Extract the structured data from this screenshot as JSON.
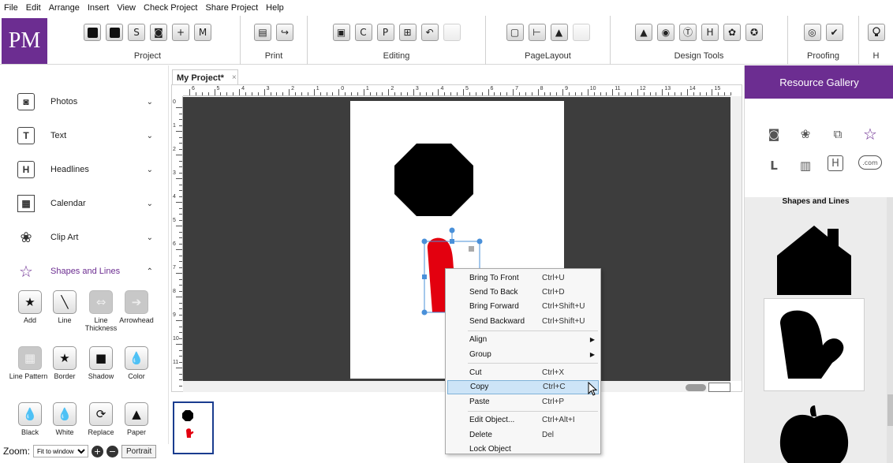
{
  "menu": [
    "File",
    "Edit",
    "Arrange",
    "Insert",
    "View",
    "Check Project",
    "Share Project",
    "Help"
  ],
  "app": {
    "logo": "PM"
  },
  "ribbon": {
    "groups": [
      {
        "label": "Project"
      },
      {
        "label": "Print"
      },
      {
        "label": "Editing"
      },
      {
        "label": "PageLayout"
      },
      {
        "label": "Design Tools"
      },
      {
        "label": "Proofing"
      },
      {
        "label": "H"
      }
    ],
    "glyphs": {
      "project_2": "S",
      "project_3": "◙",
      "project_4": "+",
      "project_5": "M",
      "print_1": "▤",
      "print_2": "↪",
      "editing_1": "▣",
      "editing_2": "C",
      "editing_3": "P",
      "editing_4": "⊞",
      "editing_5": "↶",
      "layout_1": "▢",
      "layout_2": "⊢",
      "layout_3": "▲",
      "design_1": "▲",
      "design_2": "◉",
      "design_3": "Ⓣ",
      "design_4": "H",
      "design_5": "✿",
      "design_6": "✪",
      "proof_1": "◎",
      "proof_2": "✔",
      "help_1": "💡"
    }
  },
  "left_panel": {
    "items": [
      {
        "label": "Photos",
        "icon": "camera-icon",
        "glyph": "◙"
      },
      {
        "label": "Text",
        "icon": "text-icon",
        "glyph": "T"
      },
      {
        "label": "Headlines",
        "icon": "headline-icon",
        "glyph": "H"
      },
      {
        "label": "Calendar",
        "icon": "calendar-icon",
        "glyph": "▦"
      },
      {
        "label": "Clip Art",
        "icon": "lotus-icon",
        "glyph": "❀"
      },
      {
        "label": "Shapes and Lines",
        "icon": "star-icon",
        "glyph": "☆"
      }
    ],
    "chevrons": {
      "collapsed": "⌄",
      "expanded": "⌃"
    },
    "tools": [
      {
        "label": "Add",
        "glyph": "★"
      },
      {
        "label": "Line",
        "glyph": "╲"
      },
      {
        "label": "Line Thickness",
        "glyph": "⇔"
      },
      {
        "label": "Arrowhead",
        "glyph": "➔"
      },
      {
        "label": "Line Pattern",
        "glyph": "▦"
      },
      {
        "label": "Border",
        "glyph": "★"
      },
      {
        "label": "Shadow",
        "glyph": "■"
      },
      {
        "label": "Color",
        "glyph": "💧"
      },
      {
        "label": "Black",
        "glyph": "💧"
      },
      {
        "label": "White",
        "glyph": "💧"
      },
      {
        "label": "Replace",
        "glyph": "⟳"
      },
      {
        "label": "Paper",
        "glyph": "▲"
      }
    ]
  },
  "zoom": {
    "label": "Zoom:",
    "value": "Fit to window",
    "plus": "+",
    "minus": "−",
    "orientation": "Portrait"
  },
  "document": {
    "tab": "My Project*",
    "close": "×"
  },
  "ruler": {
    "top_labels": [
      "6",
      "5",
      "4",
      "3",
      "2",
      "1",
      "0",
      "1",
      "2",
      "3",
      "4",
      "5",
      "6",
      "7",
      "8",
      "9",
      "10",
      "11",
      "12",
      "13",
      "14",
      "15"
    ],
    "left_labels": [
      "0",
      "1",
      "2",
      "3",
      "4",
      "5",
      "6",
      "7",
      "8",
      "9",
      "10",
      "11"
    ]
  },
  "context_menu": {
    "items": [
      {
        "label": "Bring To Front",
        "shortcut": "Ctrl+U"
      },
      {
        "label": "Send To Back",
        "shortcut": "Ctrl+D"
      },
      {
        "label": "Bring Forward",
        "shortcut": "Ctrl+Shift+U"
      },
      {
        "label": "Send Backward",
        "shortcut": "Ctrl+Shift+U"
      },
      {
        "label": "Align",
        "shortcut": "",
        "submenu": true
      },
      {
        "label": "Group",
        "shortcut": "",
        "submenu": true
      },
      {
        "label": "Cut",
        "shortcut": "Ctrl+X"
      },
      {
        "label": "Copy",
        "shortcut": "Ctrl+C",
        "highlighted": true
      },
      {
        "label": "Paste",
        "shortcut": "Ctrl+P"
      },
      {
        "label": "Edit Object...",
        "shortcut": "Ctrl+Alt+I"
      },
      {
        "label": "Delete",
        "shortcut": "Del"
      },
      {
        "label": "Lock Object",
        "shortcut": ""
      }
    ],
    "submenu_arrow": "▶"
  },
  "resource_gallery": {
    "title": "Resource Gallery",
    "category_title": "Shapes and Lines",
    "category_icons": [
      {
        "name": "camera-icon",
        "glyph": "◙"
      },
      {
        "name": "lotus-icon",
        "glyph": "❀"
      },
      {
        "name": "overlap-shapes-icon",
        "glyph": "⧉"
      },
      {
        "name": "star-icon",
        "glyph": "☆"
      },
      {
        "name": "layout-icon",
        "glyph": "L"
      },
      {
        "name": "columns-icon",
        "glyph": "▥"
      },
      {
        "name": "headline-icon",
        "glyph": "H"
      },
      {
        "name": "cloud-icon",
        "glyph": ".com"
      }
    ],
    "shapes": [
      "house",
      "mitten",
      "pumpkin"
    ]
  },
  "colors": {
    "brand": "#6c2d91",
    "canvas": "#3d3d3d",
    "mitten": "#e3000f",
    "selection": "#4a90d9"
  }
}
